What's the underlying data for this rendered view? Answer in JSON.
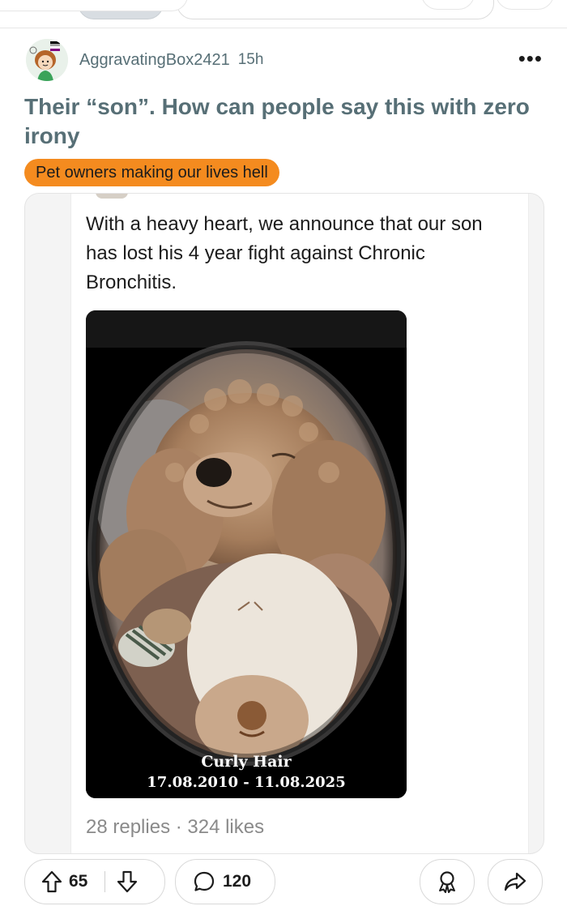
{
  "post": {
    "username": "AggravatingBox2421",
    "time": "15h",
    "more": "•••",
    "title": "Their “son”. How can people say this with zero irony",
    "flair": "Pet owners making our lives hell"
  },
  "embedded_post": {
    "text": "With a heavy heart, we announce that our son has lost his 4 year fight against Chronic Bronchitis.",
    "photo_caption_name": "Curly Hair",
    "photo_caption_dates": "17.08.2010 - 11.08.2025",
    "meta": "28 replies · 324 likes"
  },
  "actions": {
    "score": "65",
    "comments": "120"
  },
  "colors": {
    "flair_bg": "#f48b1f",
    "meta_text": "#576f76"
  },
  "icons": {
    "upvote": "arrow-up-outline",
    "downvote": "arrow-down-outline",
    "comments": "speech-bubble",
    "award": "award-ribbon",
    "share": "share-arrow"
  }
}
